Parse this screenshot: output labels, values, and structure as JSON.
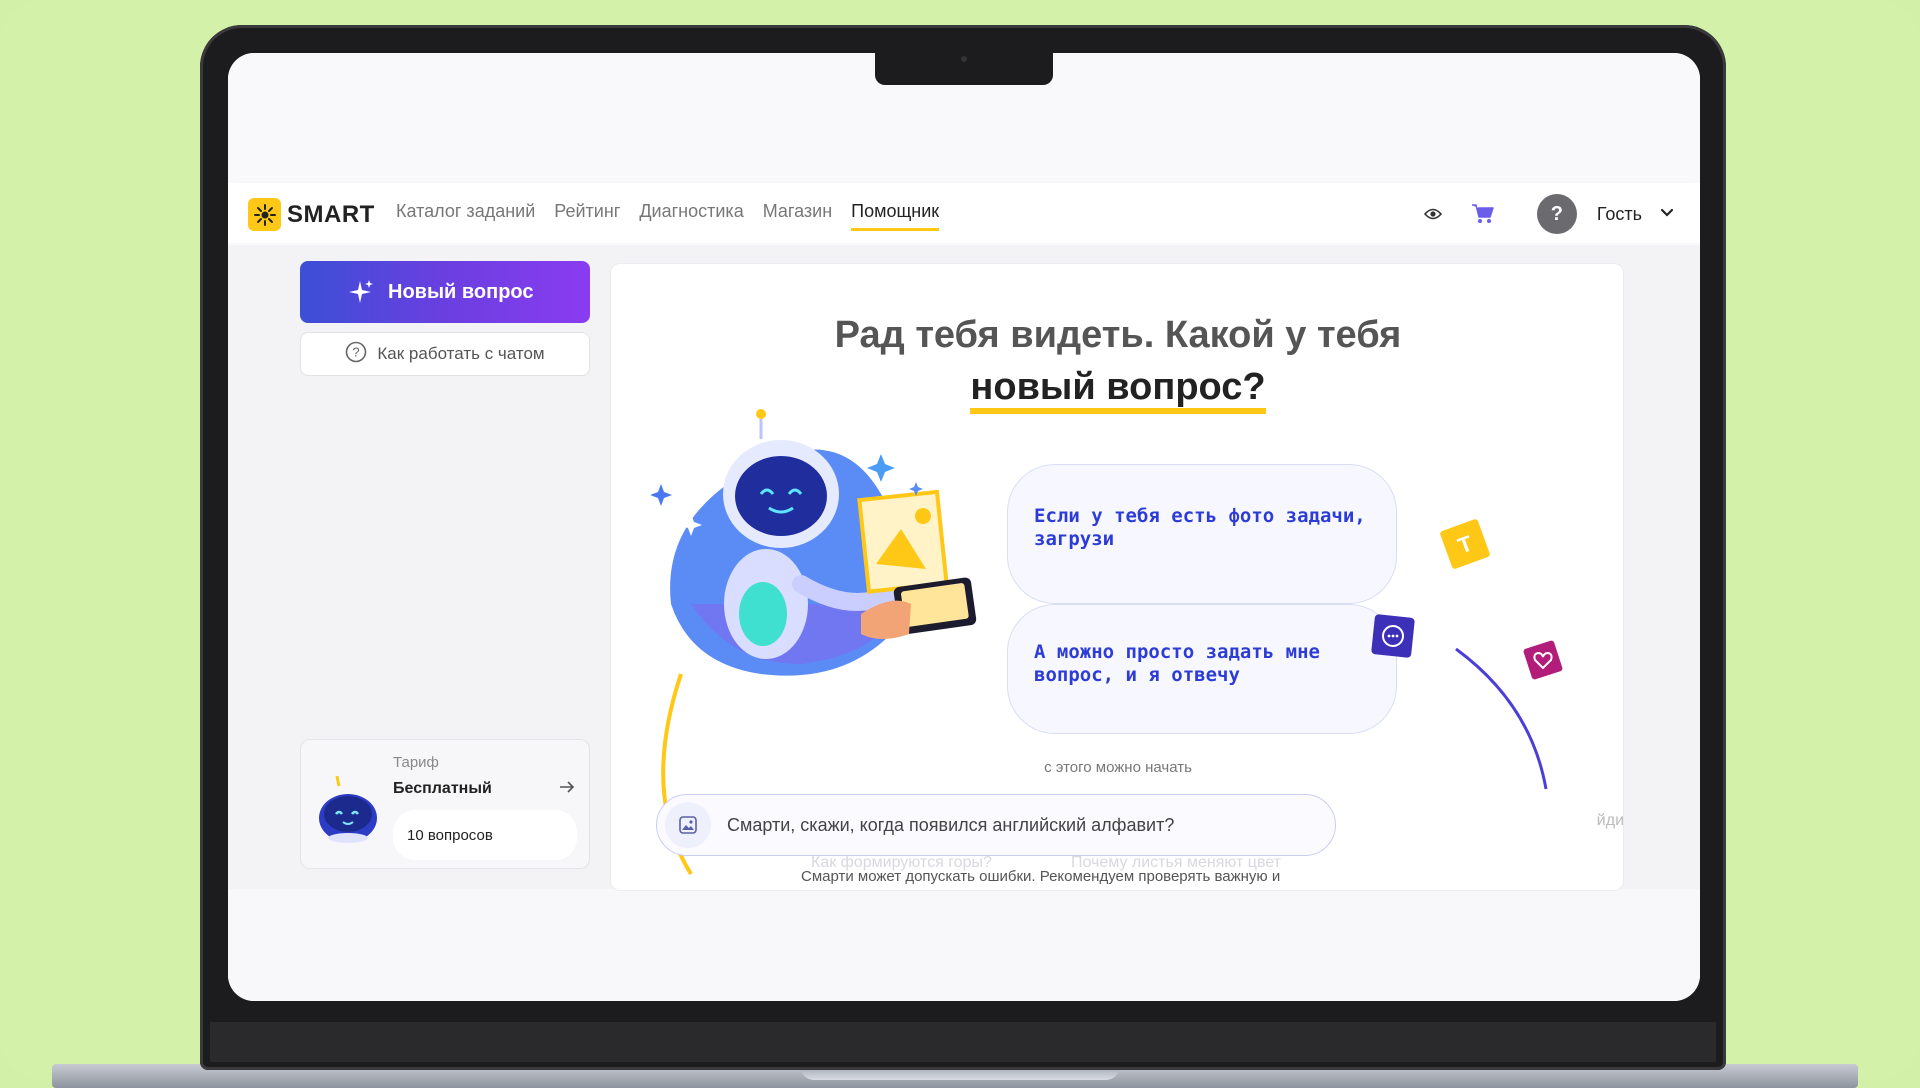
{
  "app": {
    "logo_text": "SMART"
  },
  "nav": {
    "links": [
      "Каталог заданий",
      "Рейтинг",
      "Диагностика",
      "Магазин",
      "Помощник"
    ],
    "user_avatar": "?",
    "user_name": "Гость"
  },
  "sidebar": {
    "new_question": "Новый вопрос",
    "how_it_works": "Как работать с чатом",
    "tariff": {
      "label": "Тариф",
      "name": "Бесплатный",
      "count": "10 вопросов"
    }
  },
  "main": {
    "headline_part1": "Рад тебя видеть. Какой у тебя ",
    "headline_highlight": "новый вопрос?",
    "bubble1": "Если у тебя есть фото задачи, загрузи",
    "bubble2": "А можно просто задать мне вопрос, и я отвечу",
    "start_hint": "с этого можно начать",
    "input_placeholder": "Смарти, скажи, когда появился английский алфавит?",
    "input_side_text": "йдите в",
    "suggestion1": "Как формируются горы?",
    "suggestion2": "Почему листья меняют цвет",
    "disclaimer": "Смарти может допускать ошибки. Рекомендуем проверять важную и"
  },
  "colors": {
    "accent_yellow": "#ffc816",
    "brand_blue": "#3c4fd6",
    "brand_purple": "#8a3cf0",
    "bubble_text": "#2d3cd6",
    "background_green": "#d4f1aa"
  },
  "icons": [
    "logo-sun-icon",
    "eye-icon",
    "cart-icon",
    "chevron-down-icon",
    "sparkle-icon",
    "help-circle-icon",
    "image-upload-icon",
    "arrow-right-icon"
  ]
}
